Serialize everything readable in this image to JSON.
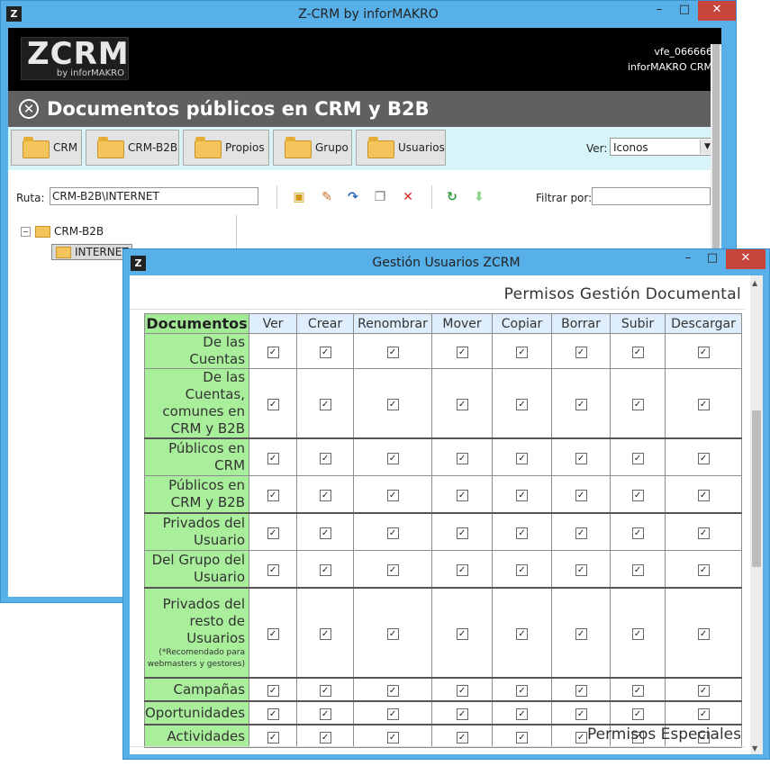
{
  "main_window": {
    "icon": "Z",
    "title": "Z-CRM by inforMAKRO",
    "logo_main": "ZCRM",
    "logo_sub": "by inforMAKRO",
    "user_id": "vfe_066666",
    "user_company": "inforMAKRO CRM",
    "section_title": "Documentos públicos en CRM y B2B",
    "tabs": [
      {
        "label": "CRM"
      },
      {
        "label": "CRM-B2B"
      },
      {
        "label": "Propios"
      },
      {
        "label": "Grupo"
      },
      {
        "label": "Usuarios"
      }
    ],
    "view_label": "Ver:",
    "view_value": "Iconos",
    "path_label": "Ruta:",
    "path_value": "CRM-B2B\\INTERNET",
    "filter_label": "Filtrar por:",
    "filter_value": "",
    "tree": {
      "root": "CRM-B2B",
      "child": "INTERNET"
    },
    "toolbar_icons": [
      "new-folder-icon",
      "rename-icon",
      "move-icon",
      "copy-icon",
      "delete-icon",
      "refresh-icon",
      "download-icon"
    ],
    "controls": {
      "minimize": "–",
      "maximize": "□",
      "close": "✕"
    }
  },
  "dialog": {
    "icon": "Z",
    "title": "Gestión Usuarios ZCRM",
    "perm_title": "Permisos Gestión Documental",
    "special_title": "Permisos Especiales",
    "columns": [
      "Documentos",
      "Ver",
      "Crear",
      "Renombrar",
      "Mover",
      "Copiar",
      "Borrar",
      "Subir",
      "Descargar"
    ],
    "rows": [
      {
        "label": "De las Cuentas",
        "checked": [
          true,
          true,
          true,
          true,
          true,
          true,
          true,
          true
        ]
      },
      {
        "label": "De las Cuentas, comunes en CRM y B2B",
        "checked": [
          true,
          true,
          true,
          true,
          true,
          true,
          true,
          true
        ]
      },
      {
        "label": "Públicos en CRM",
        "checked": [
          true,
          true,
          true,
          true,
          true,
          true,
          true,
          true
        ]
      },
      {
        "label": "Públicos en CRM y B2B",
        "checked": [
          true,
          true,
          true,
          true,
          true,
          true,
          true,
          true
        ]
      },
      {
        "label": "Privados del Usuario",
        "checked": [
          true,
          true,
          true,
          true,
          true,
          true,
          true,
          true
        ]
      },
      {
        "label": "Del Grupo del Usuario",
        "checked": [
          true,
          true,
          true,
          true,
          true,
          true,
          true,
          true
        ]
      },
      {
        "label": "Privados del resto de Usuarios",
        "note": "(*Recomendado para webmasters y gestores)",
        "checked": [
          true,
          true,
          true,
          true,
          true,
          true,
          true,
          true
        ]
      },
      {
        "label": "Campañas",
        "checked": [
          true,
          true,
          true,
          true,
          true,
          true,
          true,
          true
        ]
      },
      {
        "label": "Oportunidades",
        "checked": [
          true,
          true,
          true,
          true,
          true,
          true,
          true,
          true
        ]
      },
      {
        "label": "Actividades",
        "checked": [
          true,
          true,
          true,
          true,
          true,
          true,
          true,
          true
        ]
      }
    ],
    "controls": {
      "minimize": "–",
      "maximize": "□",
      "close": "✕"
    }
  },
  "colors": {
    "window_frame": "#58b0e8",
    "close_button": "#c7453b",
    "section_bar": "#606060",
    "tab_strip": "#d7f5f9",
    "row_label_bg": "#a8ee9b",
    "header_bg": "#dfeefd"
  }
}
